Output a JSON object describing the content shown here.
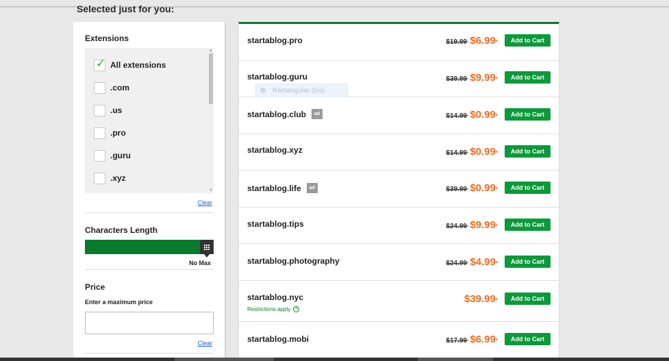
{
  "heading": "Selected just for you:",
  "filters": {
    "extensions": {
      "title": "Extensions",
      "items": [
        {
          "label": "All extensions",
          "checked": true
        },
        {
          "label": ".com",
          "checked": false
        },
        {
          "label": ".us",
          "checked": false
        },
        {
          "label": ".pro",
          "checked": false
        },
        {
          "label": ".guru",
          "checked": false
        },
        {
          "label": ".xyz",
          "checked": false
        }
      ],
      "clear": "Clear"
    },
    "characters_length": {
      "title": "Characters Length",
      "max_label": "No Max"
    },
    "price": {
      "title": "Price",
      "subtitle": "Enter a maximum price",
      "input_value": "",
      "clear": "Clear"
    }
  },
  "results": [
    {
      "domain": "startablog.pro",
      "old_price": "$19.99",
      "new_price": "$6.99",
      "ad": false,
      "note": ""
    },
    {
      "domain": "startablog.guru",
      "old_price": "$39.99",
      "new_price": "$9.99",
      "ad": false,
      "note": ""
    },
    {
      "domain": "startablog.club",
      "old_price": "$14.99",
      "new_price": "$0.99",
      "ad": true,
      "note": ""
    },
    {
      "domain": "startablog.xyz",
      "old_price": "$14.99",
      "new_price": "$0.99",
      "ad": false,
      "note": ""
    },
    {
      "domain": "startablog.life",
      "old_price": "$39.99",
      "new_price": "$0.99",
      "ad": true,
      "note": ""
    },
    {
      "domain": "startablog.tips",
      "old_price": "$24.99",
      "new_price": "$9.99",
      "ad": false,
      "note": ""
    },
    {
      "domain": "startablog.photography",
      "old_price": "$24.99",
      "new_price": "$4.99",
      "ad": false,
      "note": ""
    },
    {
      "domain": "startablog.nyc",
      "old_price": "",
      "new_price": "$39.99",
      "ad": false,
      "note": "Restrictions apply"
    },
    {
      "domain": "startablog.mobi",
      "old_price": "$17.99",
      "new_price": "$6.99",
      "ad": false,
      "note": ""
    }
  ],
  "labels": {
    "add_to_cart": "Add to Cart",
    "ad": "ad",
    "star": "*",
    "question": "?"
  },
  "overlay": {
    "snip_label": "Rectangular Snip"
  },
  "colors": {
    "accent_green": "#0a7a2b",
    "button_green": "#0a9a3a",
    "price_orange": "#f26a1b",
    "check_green": "#36a336"
  },
  "icons": {
    "checkbox_checked": "checkmark-icon",
    "slider_handle": "grid-icon",
    "restrictions": "question-circle-icon"
  }
}
